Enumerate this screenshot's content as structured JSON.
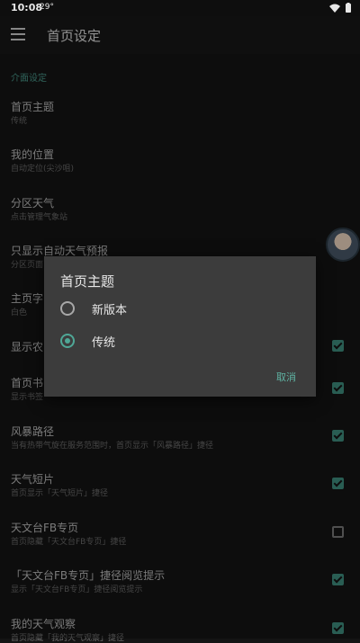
{
  "status": {
    "time": "10:08",
    "temperature": "29°"
  },
  "header": {
    "title": "首页设定"
  },
  "section": {
    "label": "介面设定"
  },
  "rows": [
    {
      "title": "首页主题",
      "subtitle": "传统"
    },
    {
      "title": "我的位置",
      "subtitle": "自动定位(尖沙咀)"
    },
    {
      "title": "分区天气",
      "subtitle": "点击管理气象站"
    },
    {
      "title": "只显示自动天气预报",
      "subtitle": "分区页面"
    },
    {
      "title": "主页字",
      "subtitle": "白色"
    },
    {
      "title": "显示农",
      "subtitle": "",
      "checked": true
    },
    {
      "title": "首页书",
      "subtitle": "显示书签",
      "checked": true
    },
    {
      "title": "风暴路径",
      "subtitle": "当有热带气旋在服务范围时，首页显示「风暴路径」捷径",
      "checked": true
    },
    {
      "title": "天气短片",
      "subtitle": "首页显示「天气短片」捷径",
      "checked": true
    },
    {
      "title": "天文台FB专页",
      "subtitle": "首页隐藏「天文台FB专页」捷径",
      "checked": false
    },
    {
      "title": "「天文台FB专页」捷径阅览提示",
      "subtitle": "显示「天文台FB专页」捷径阅览提示",
      "checked": true
    },
    {
      "title": "我的天气观察",
      "subtitle": "首页隐藏「我的天气观察」捷径",
      "checked": true
    }
  ],
  "dialog": {
    "title": "首页主题",
    "options": [
      {
        "label": "新版本",
        "selected": false
      },
      {
        "label": "传统",
        "selected": true
      }
    ],
    "cancel_label": "取消"
  },
  "colors": {
    "accent": "#4fa796",
    "background": "#141414",
    "dialog": "#3c3c3c"
  }
}
